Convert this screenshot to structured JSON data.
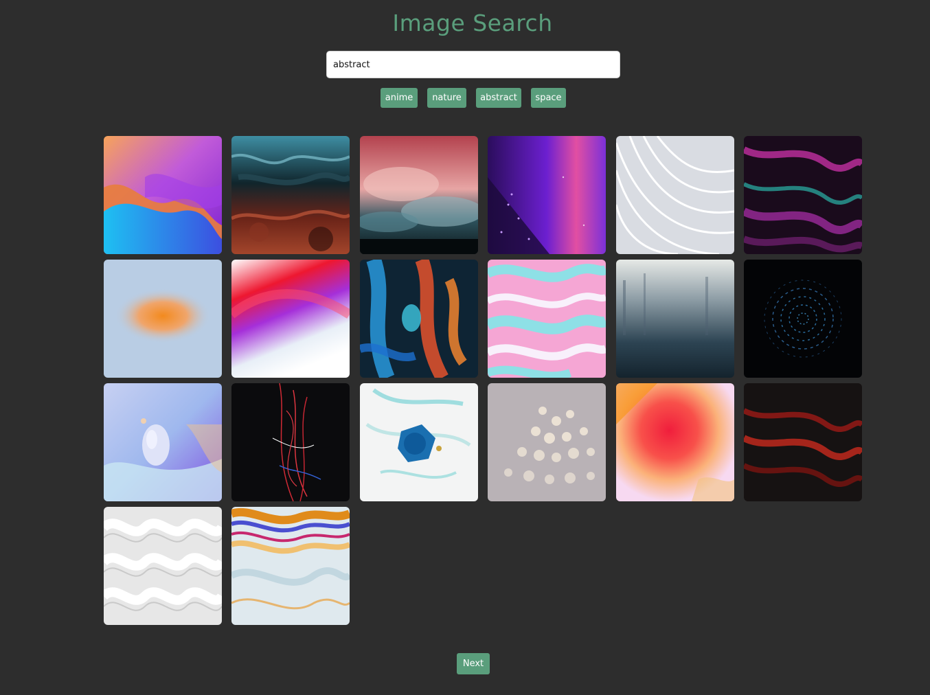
{
  "header": {
    "title": "Image Search"
  },
  "search": {
    "value": "abstract"
  },
  "tags": [
    {
      "label": "anime"
    },
    {
      "label": "nature"
    },
    {
      "label": "abstract"
    },
    {
      "label": "space"
    }
  ],
  "gallery": {
    "images": [
      {
        "subject": "purple-blue-orange wave gradient"
      },
      {
        "subject": "teal and rust marbled ink"
      },
      {
        "subject": "pink and teal smoke clouds"
      },
      {
        "subject": "purple neon glass rain"
      },
      {
        "subject": "white wavy lines"
      },
      {
        "subject": "magenta teal fractal fur"
      },
      {
        "subject": "orange blur on pale blue"
      },
      {
        "subject": "red purple white swirl"
      },
      {
        "subject": "blue orange ink in water"
      },
      {
        "subject": "pink teal marble liquid"
      },
      {
        "subject": "misty dark blue fog"
      },
      {
        "subject": "dark blue dotted sphere"
      },
      {
        "subject": "lavender 3d bubble"
      },
      {
        "subject": "red light trails on black"
      },
      {
        "subject": "blue ink splash on white"
      },
      {
        "subject": "beige bokeh lights"
      },
      {
        "subject": "red orange pink gradient"
      },
      {
        "subject": "red black fractal"
      },
      {
        "subject": "white woven pattern"
      },
      {
        "subject": "iridescent soap film"
      }
    ]
  },
  "pagination": {
    "next_label": "Next"
  }
}
